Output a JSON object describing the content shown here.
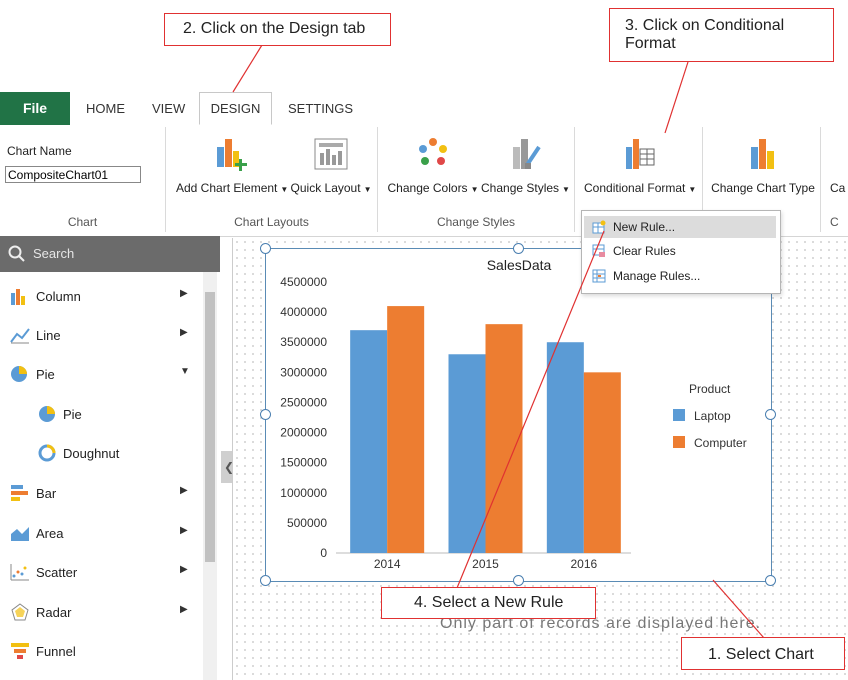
{
  "tabs": {
    "file": "File",
    "home": "HOME",
    "view": "VIEW",
    "design": "DESIGN",
    "settings": "SETTINGS"
  },
  "ribbon": {
    "chart_name_label": "Chart Name",
    "chart_name_value": "CompositeChart01",
    "groups": {
      "chart": "Chart",
      "chart_layouts": "Chart Layouts",
      "change_styles": "Change Styles"
    },
    "buttons": {
      "add_chart_element": "Add Chart Element",
      "quick_layout": "Quick Layout",
      "change_colors": "Change Colors",
      "change_styles": "Change Styles",
      "conditional_format": "Conditional Format",
      "change_chart_type": "Change Chart Type",
      "cut_off": "Ca"
    }
  },
  "dropdown": {
    "new_rule": "New Rule...",
    "clear_rules": "Clear Rules",
    "manage_rules": "Manage Rules..."
  },
  "sidebar": {
    "search_placeholder": "Search",
    "items": [
      "Column",
      "Line",
      "Pie",
      "Pie",
      "Doughnut",
      "Bar",
      "Area",
      "Scatter",
      "Radar",
      "Funnel"
    ]
  },
  "canvas": {
    "note": "Only part of records are displayed here."
  },
  "callouts": {
    "step1": "1. Select Chart",
    "step2": "2. Click on the Design tab",
    "step3": "3. Click on Conditional Format",
    "step4": "4. Select a New Rule"
  },
  "colors": {
    "laptop": "#5b9bd5",
    "computer": "#ed7d31",
    "accent": "#217346",
    "callout_border": "#e03131"
  },
  "chart_data": {
    "type": "bar",
    "title": "SalesData",
    "categories": [
      "2014",
      "2015",
      "2016"
    ],
    "series": [
      {
        "name": "Laptop",
        "values": [
          3700000,
          3300000,
          3500000
        ]
      },
      {
        "name": "Computer",
        "values": [
          4100000,
          3800000,
          3000000
        ]
      }
    ],
    "legend_title": "Product",
    "legend_position": "right",
    "ylim": [
      0,
      4500000
    ],
    "yticks": [
      "0",
      "500000",
      "1000000",
      "1500000",
      "2000000",
      "2500000",
      "3000000",
      "3500000",
      "4000000",
      "4500000"
    ]
  }
}
